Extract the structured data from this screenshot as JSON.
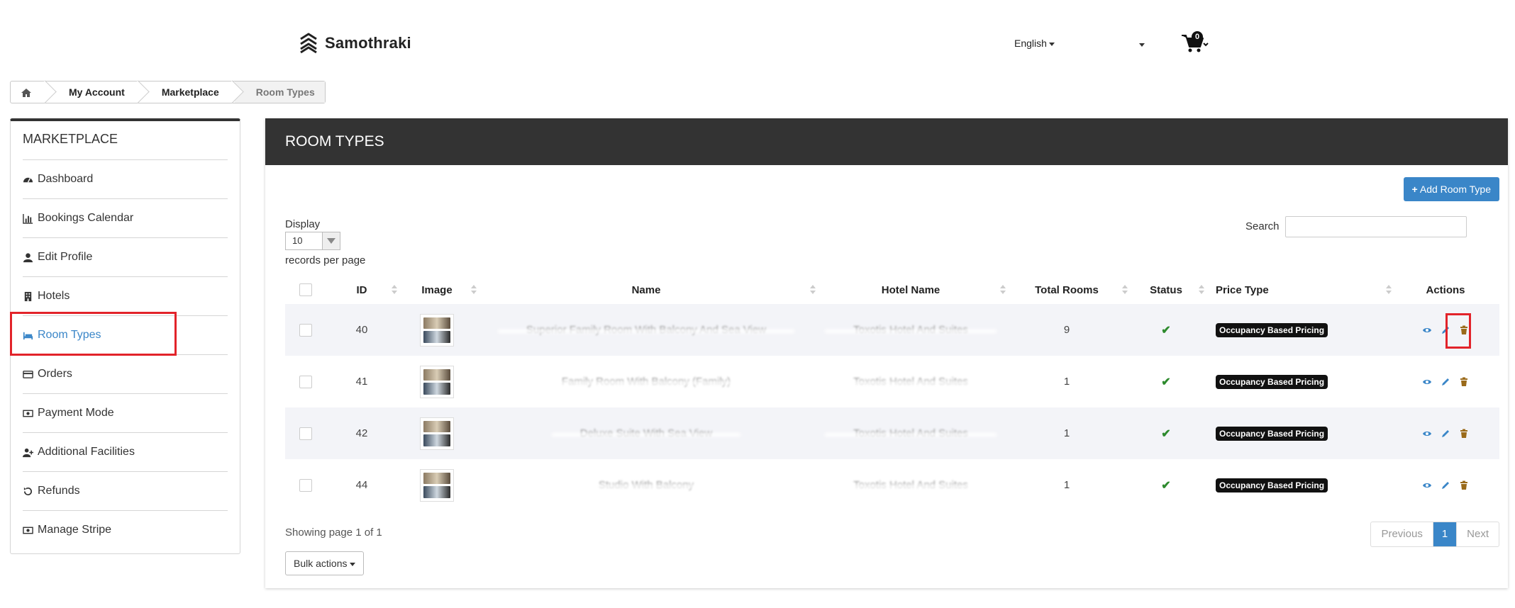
{
  "header": {
    "brand": "Samothraki",
    "language": "English",
    "cart_count": "0"
  },
  "breadcrumb": {
    "items": [
      "My Account",
      "Marketplace",
      "Room Types"
    ]
  },
  "sidebar": {
    "title": "MARKETPLACE",
    "items": [
      {
        "label": "Dashboard",
        "icon": "dashboard-icon"
      },
      {
        "label": "Bookings Calendar",
        "icon": "bar-chart-icon"
      },
      {
        "label": "Edit Profile",
        "icon": "user-icon"
      },
      {
        "label": "Hotels",
        "icon": "building-icon"
      },
      {
        "label": "Room Types",
        "icon": "bed-icon",
        "active": true
      },
      {
        "label": "Orders",
        "icon": "credit-card-icon"
      },
      {
        "label": "Payment Mode",
        "icon": "money-icon"
      },
      {
        "label": "Additional Facilities",
        "icon": "user-plus-icon"
      },
      {
        "label": "Refunds",
        "icon": "refresh-icon"
      },
      {
        "label": "Manage Stripe",
        "icon": "money-icon"
      }
    ]
  },
  "main": {
    "title": "ROOM TYPES",
    "add_button": "Add Room Type",
    "display_label": "Display",
    "display_value": "10",
    "records_label": "records per page",
    "search_label": "Search",
    "search_value": "",
    "columns": [
      "ID",
      "Image",
      "Name",
      "Hotel Name",
      "Total Rooms",
      "Status",
      "Price Type",
      "Actions"
    ],
    "rows": [
      {
        "id": "40",
        "name": "Superior Family Room With Balcony And Sea View",
        "hotel": "Toxotis Hotel And Suites",
        "total": "9",
        "price_type": "Occupancy Based Pricing"
      },
      {
        "id": "41",
        "name": "Family Room With Balcony (Family)",
        "hotel": "Toxotis Hotel And Suites",
        "total": "1",
        "price_type": "Occupancy Based Pricing"
      },
      {
        "id": "42",
        "name": "Deluxe Suite With Sea View",
        "hotel": "Toxotis Hotel And Suites",
        "total": "1",
        "price_type": "Occupancy Based Pricing"
      },
      {
        "id": "44",
        "name": "Studio With Balcony",
        "hotel": "Toxotis Hotel And Suites",
        "total": "1",
        "price_type": "Occupancy Based Pricing"
      }
    ],
    "showing": "Showing page 1 of 1",
    "bulk_actions": "Bulk actions",
    "pagination": {
      "previous": "Previous",
      "current": "1",
      "next": "Next"
    }
  },
  "colors": {
    "accent": "#3a86c8",
    "header_dark": "#333333",
    "highlight": "#e2232a",
    "success": "#2d8a2d"
  }
}
